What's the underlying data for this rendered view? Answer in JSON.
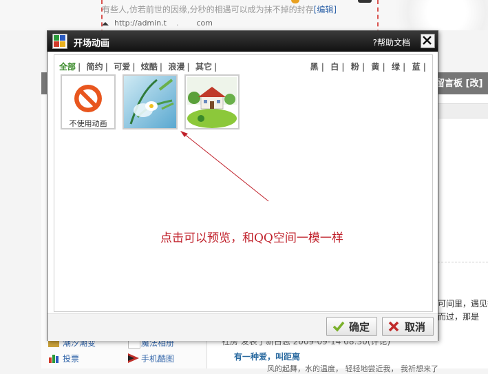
{
  "background": {
    "top_text": "有些人,仿若前世的因缘,分秒的相遇可以成为抹不掉的封存",
    "top_edit": "[编辑]",
    "url_text": "http://admin.t",
    "url_suffix": "com",
    "board_text": "留言板 [改]",
    "snippet_1": "可间里，遇见彼",
    "snippet_2": "而过，那是",
    "left_item_1": "潮汐潮变",
    "left_item_2": "魔法相册",
    "left_item_3": "投票",
    "left_item_4": "手机酷图",
    "news_line": "社房 发表了新日志  2009-09-14 08:30(评论)",
    "news_title": "有一种爱，叫距离",
    "news_body": "风的起舞，水的温度，    轻轻地尝近我，    我祈想来了"
  },
  "dialog": {
    "title": "开场动画",
    "help": "?帮助文档",
    "tabs": [
      "全部",
      "简约",
      "可爱",
      "炫酷",
      "浪漫",
      "其它"
    ],
    "active_tab": "全部",
    "colors": [
      "黑",
      "白",
      "粉",
      "黄",
      "绿",
      "蓝"
    ],
    "thumbs": [
      {
        "name": "no-animation",
        "caption": "不使用动画"
      },
      {
        "name": "flower",
        "caption": ""
      },
      {
        "name": "house",
        "caption": ""
      }
    ],
    "annotation": "点击可以预览，和QQ空间一模一样",
    "ok_label": "确定",
    "cancel_label": "取消"
  },
  "colors": {
    "accent_green": "#3a8a2a",
    "annotation_red": "#c0202a",
    "titlebar": "#1a1a1a"
  }
}
